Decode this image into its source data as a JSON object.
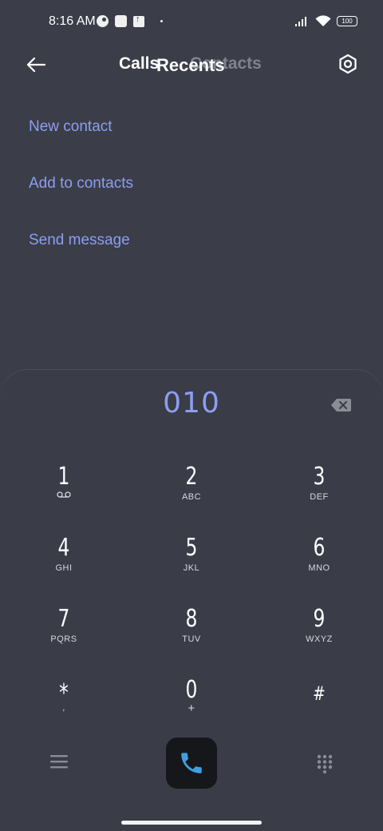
{
  "status_bar": {
    "time": "8:16 AM",
    "battery": "100"
  },
  "header": {
    "tab_calls": "Calls",
    "tab_recents": "Recents",
    "tab_contacts": "Contacts"
  },
  "actions": [
    "New contact",
    "Add to contacts",
    "Send message"
  ],
  "dialer": {
    "number": "010",
    "keys": [
      {
        "digit": "1",
        "letters": ""
      },
      {
        "digit": "2",
        "letters": "ABC"
      },
      {
        "digit": "3",
        "letters": "DEF"
      },
      {
        "digit": "4",
        "letters": "GHI"
      },
      {
        "digit": "5",
        "letters": "JKL"
      },
      {
        "digit": "6",
        "letters": "MNO"
      },
      {
        "digit": "7",
        "letters": "PQRS"
      },
      {
        "digit": "8",
        "letters": "TUV"
      },
      {
        "digit": "9",
        "letters": "WXYZ"
      },
      {
        "digit": "*",
        "letters": ","
      },
      {
        "digit": "0",
        "letters": "+"
      },
      {
        "digit": "#",
        "letters": ""
      }
    ]
  },
  "icons": {
    "back": "back-arrow-icon",
    "settings": "settings-icon",
    "delete": "backspace-icon",
    "menu": "menu-icon",
    "call": "phone-icon",
    "keypad": "keypad-icon"
  },
  "colors": {
    "background": "#3b3d48",
    "accent": "#8d9ef0",
    "call_icon": "#3f9fe3"
  }
}
